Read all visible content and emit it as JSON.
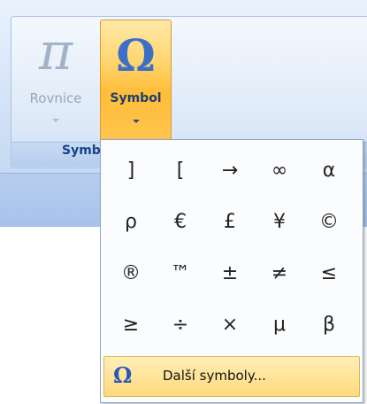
{
  "ribbon": {
    "group_label": "Symb",
    "buttons": [
      {
        "label": "Rovnice",
        "icon": "pi-icon",
        "glyph": "π"
      },
      {
        "label": "Symbol",
        "icon": "omega-icon",
        "glyph": "Ω"
      }
    ]
  },
  "dropdown": {
    "symbols": [
      "]",
      "[",
      "→",
      "∞",
      "α",
      "ρ",
      "€",
      "£",
      "¥",
      "©",
      "®",
      "™",
      "±",
      "≠",
      "≤",
      "≥",
      "÷",
      "×",
      "μ",
      "β"
    ],
    "more": {
      "icon_glyph": "Ω",
      "label": "Další symboly..."
    }
  },
  "colors": {
    "active_button": "#ffc54e",
    "omega_icon": "#3b6fc8",
    "label_text": "#15428b"
  }
}
